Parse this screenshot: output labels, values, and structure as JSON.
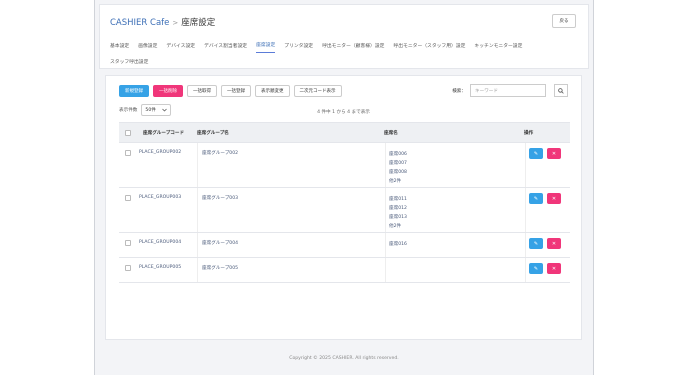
{
  "header": {
    "app_name": "CASHIER Cafe",
    "separator": ">",
    "page_title": "座席設定",
    "back_label": "戻る"
  },
  "tabs": [
    {
      "label": "基本設定",
      "active": false
    },
    {
      "label": "画像設定",
      "active": false
    },
    {
      "label": "デバイス設定",
      "active": false
    },
    {
      "label": "デバイス割当者設定",
      "active": false
    },
    {
      "label": "座席設定",
      "active": true
    },
    {
      "label": "プリンタ設定",
      "active": false
    },
    {
      "label": "呼出モニター（顧客様）設定",
      "active": false
    },
    {
      "label": "呼出モニター（スタッフ用）設定",
      "active": false
    },
    {
      "label": "キッチンモニター設定",
      "active": false
    },
    {
      "label": "スタッフ呼出設定",
      "active": false
    }
  ],
  "toolbar": {
    "new_label": "新規登録",
    "bulk_delete_label": "一括削除",
    "bulk_get_label": "一括取得",
    "bulk_register_label": "一括登録",
    "order_change_label": "表示順変更",
    "qr_label": "二次元コード表示"
  },
  "search": {
    "label": "検索：",
    "placeholder": "キーワード"
  },
  "list": {
    "count_label": "表示件数",
    "count_value": "50件",
    "range_text": "4 件中 1 から 4 まで表示"
  },
  "table": {
    "headers": {
      "code": "座席グループコード",
      "name": "座席グループ名",
      "seats": "座席名",
      "ops": "操作"
    },
    "rows": [
      {
        "code": "PLACE_GROUP002",
        "name": "座席グループ002",
        "seats": [
          "座席006",
          "座席007",
          "座席008",
          "他2件"
        ]
      },
      {
        "code": "PLACE_GROUP003",
        "name": "座席グループ003",
        "seats": [
          "座席011",
          "座席012",
          "座席013",
          "他2件"
        ]
      },
      {
        "code": "PLACE_GROUP004",
        "name": "座席グループ004",
        "seats": [
          "座席016"
        ]
      },
      {
        "code": "PLACE_GROUP005",
        "name": "座席グループ005",
        "seats": []
      }
    ]
  },
  "footer": {
    "copyright": "Copyright © 2025 CASHIER. All rights reserved."
  },
  "colors": {
    "primary": "#36a2e6",
    "danger": "#f0367a",
    "link": "#3d6fb6",
    "active_tab_underline": "#5b7cd8"
  },
  "icons": {
    "search": "search-icon",
    "edit": "edit-icon",
    "delete": "close-icon",
    "chevron": "chevron-down-icon"
  }
}
